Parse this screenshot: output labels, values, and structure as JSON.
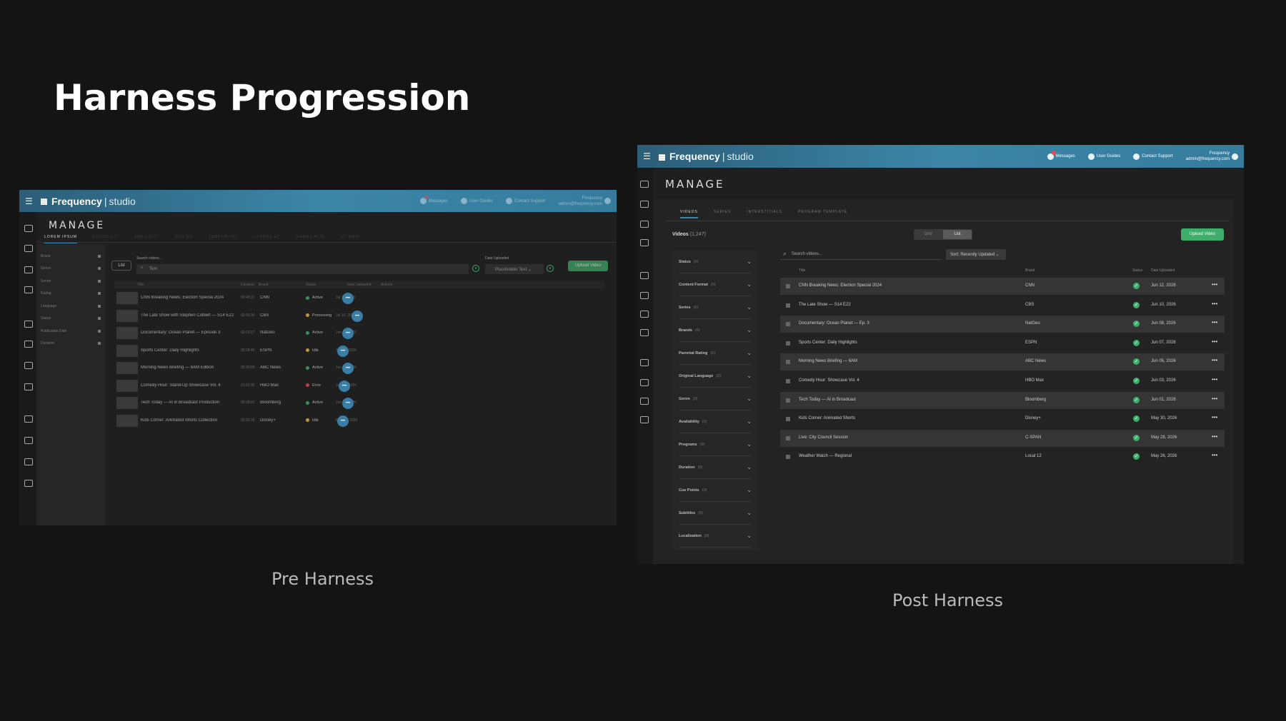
{
  "slide": {
    "title": "Harness Progression",
    "pre_caption": "Pre Harness",
    "post_caption": "Post Harness"
  },
  "brand": {
    "name": "Frequency",
    "product": "studio",
    "user_name": "Frequency",
    "user_email": "admin@frequency.com"
  },
  "topnav": {
    "messages": "Messages",
    "user_guides": "User Guides",
    "contact_support": "Contact Support"
  },
  "pre": {
    "page_title": "MANAGE",
    "tabs": [
      "LOREM IPSUM",
      "DOLOR SIT",
      "AMET ELIT",
      "SED DO",
      "TEMPOR INC",
      "LABORE ET",
      "MAGNA ALIQ",
      "UT ENIM"
    ],
    "filters": [
      "Brand",
      "Genre",
      "Series",
      "Rating",
      "Language",
      "Status",
      "Publication Date",
      "Duration"
    ],
    "view_toggle": "List",
    "search_label": "Search videos...",
    "search_placeholder": "Text",
    "date_label": "Date Uploaded",
    "date_value": "Placeholder Text",
    "upload_button": "Upload Video",
    "columns": [
      "Title",
      "Duration",
      "Brand",
      "Status",
      "Date Uploaded",
      "Actions"
    ],
    "rows": [
      {
        "title": "CNN Breaking News: Election Special 2024",
        "duration": "00:45:22",
        "brand": "CNN",
        "status": "Active",
        "status_color": "#3fae6a",
        "date": "Jul 12, 2026"
      },
      {
        "title": "The Late Show with Stephen Colbert — S14 E22",
        "duration": "00:58:14",
        "brand": "CBS",
        "status": "Processing",
        "status_color": "#e8b83c",
        "date": "Jul 10, 2026"
      },
      {
        "title": "Documentary: Ocean Planet — Episode 3",
        "duration": "00:52:07",
        "brand": "NatGeo",
        "status": "Active",
        "status_color": "#3fae6a",
        "date": "Jun 08, 2026"
      },
      {
        "title": "Sports Center: Daily Highlights",
        "duration": "00:28:45",
        "brand": "ESPN",
        "status": "Idle",
        "status_color": "#e8b83c",
        "date": "Jun 07, 2026"
      },
      {
        "title": "Morning News Briefing — 6AM Edition",
        "duration": "00:30:00",
        "brand": "ABC News",
        "status": "Active",
        "status_color": "#3fae6a",
        "date": "Jun 05, 2026"
      },
      {
        "title": "Comedy Hour: Stand-Up Showcase Vol. 4",
        "duration": "01:02:30",
        "brand": "HBO Max",
        "status": "Error",
        "status_color": "#e84a4a",
        "date": "Jun 03, 2026"
      },
      {
        "title": "Tech Today — AI in Broadcast Production",
        "duration": "00:38:55",
        "brand": "Bloomberg",
        "status": "Active",
        "status_color": "#3fae6a",
        "date": "Jun 01, 2026"
      },
      {
        "title": "Kids Corner: Animated Shorts Collection",
        "duration": "00:22:18",
        "brand": "Disney+",
        "status": "Idle",
        "status_color": "#e8b83c",
        "date": "May 30, 2026"
      }
    ]
  },
  "post": {
    "page_title": "MANAGE",
    "tabs": [
      "VIDEOS",
      "SERIES",
      "INTERSTITIALS",
      "PROGRAM TEMPLATE"
    ],
    "videos_label": "Videos",
    "videos_count": "(1,247)",
    "view_grid": "Grid",
    "view_list": "List",
    "upload_button": "Upload Video",
    "search_placeholder": "Search videos...",
    "sort_label": "Sort: Recently Updated",
    "filters": [
      {
        "label": "Status",
        "count": "(0)"
      },
      {
        "label": "Content Format",
        "count": "(0)"
      },
      {
        "label": "Series",
        "count": "(0)"
      },
      {
        "label": "Brands",
        "count": "(0)"
      },
      {
        "label": "Parental Rating",
        "count": "(0)"
      },
      {
        "label": "Original Language",
        "count": "(0)"
      },
      {
        "label": "Genre",
        "count": "(0)"
      },
      {
        "label": "Availability",
        "count": "(0)"
      },
      {
        "label": "Programs",
        "count": "(0)"
      },
      {
        "label": "Duration",
        "count": "(0)"
      },
      {
        "label": "Cue Points",
        "count": "(0)"
      },
      {
        "label": "Subtitles",
        "count": "(0)"
      },
      {
        "label": "Localization",
        "count": "(0)"
      }
    ],
    "columns": [
      "Title",
      "Brand",
      "Status",
      "Date Uploaded"
    ],
    "rows": [
      {
        "title": "CNN Breaking News: Election Special 2024",
        "brand": "CNN",
        "date": "Jun 12, 2026"
      },
      {
        "title": "The Late Show — S14 E22",
        "brand": "CBS",
        "date": "Jun 10, 2026"
      },
      {
        "title": "Documentary: Ocean Planet — Ep. 3",
        "brand": "NatGeo",
        "date": "Jun 08, 2026"
      },
      {
        "title": "Sports Center: Daily Highlights",
        "brand": "ESPN",
        "date": "Jun 07, 2026"
      },
      {
        "title": "Morning News Briefing — 6AM",
        "brand": "ABC News",
        "date": "Jun 05, 2026"
      },
      {
        "title": "Comedy Hour: Showcase Vol. 4",
        "brand": "HBO Max",
        "date": "Jun 03, 2026"
      },
      {
        "title": "Tech Today — AI in Broadcast",
        "brand": "Bloomberg",
        "date": "Jun 01, 2026"
      },
      {
        "title": "Kids Corner: Animated Shorts",
        "brand": "Disney+",
        "date": "May 30, 2026"
      },
      {
        "title": "Live: City Council Session",
        "brand": "C-SPAN",
        "date": "May 28, 2026"
      },
      {
        "title": "Weather Watch — Regional",
        "brand": "Local 12",
        "date": "May 26, 2026"
      }
    ]
  }
}
